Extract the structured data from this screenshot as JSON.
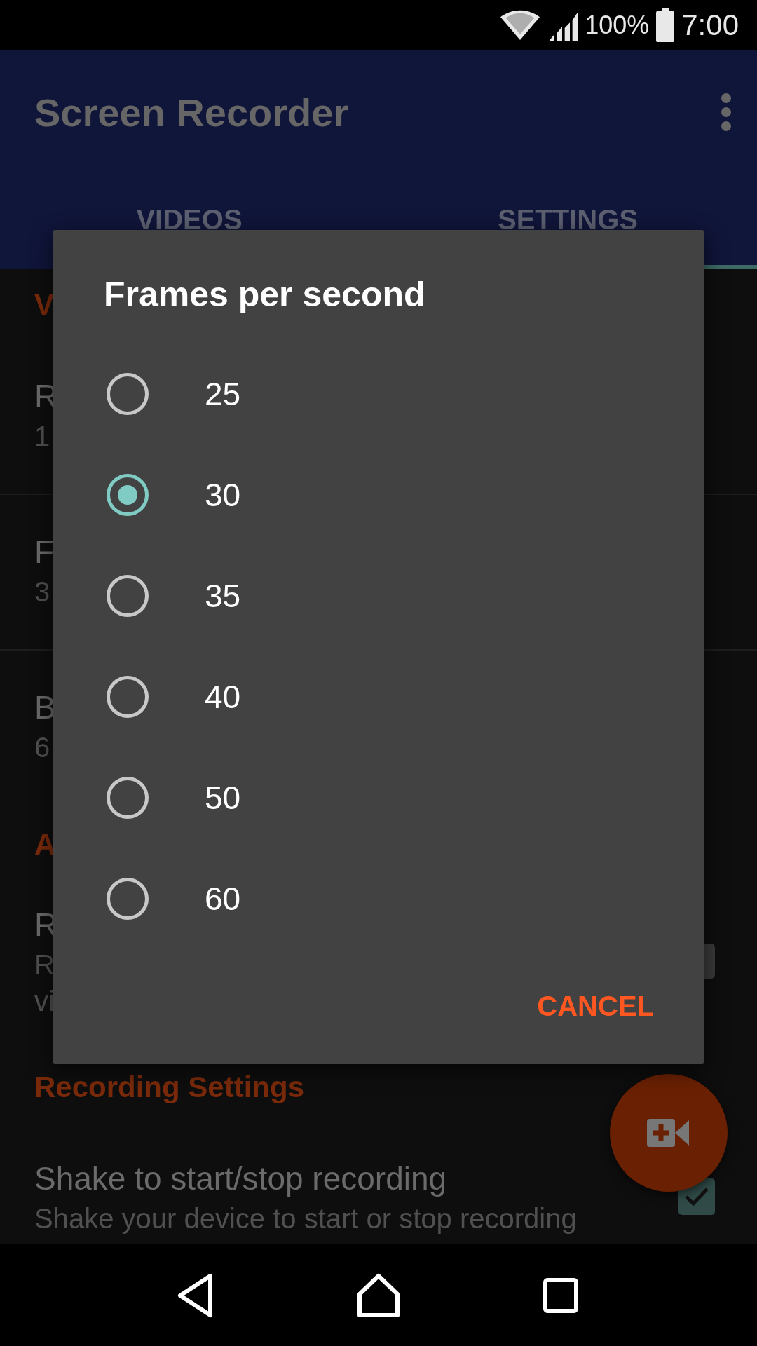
{
  "status_bar": {
    "battery_text": "100%",
    "time": "7:00"
  },
  "app_bar": {
    "title": "Screen Recorder"
  },
  "tabs": [
    {
      "label": "VIDEOS",
      "selected": false
    },
    {
      "label": "SETTINGS",
      "selected": true
    }
  ],
  "sections": [
    {
      "header": "V",
      "items": [
        {
          "title": "R",
          "summary": [
            "1"
          ],
          "kind": "plain"
        },
        {
          "title": "F",
          "summary": [
            "3"
          ],
          "kind": "plain"
        },
        {
          "title": "B",
          "summary": [
            "6"
          ],
          "kind": "plain"
        }
      ]
    },
    {
      "header": "A",
      "items": [
        {
          "title": "R",
          "summary": [
            "R",
            "vi"
          ],
          "kind": "switch"
        }
      ]
    },
    {
      "header": "Recording Settings",
      "items": [
        {
          "title": "Shake to start/stop recording",
          "summary": [
            "Shake your device to start or stop recording"
          ],
          "kind": "checkbox",
          "checked": true
        }
      ]
    }
  ],
  "dialog": {
    "title": "Frames per second",
    "options": [
      {
        "label": "25",
        "selected": false
      },
      {
        "label": "30",
        "selected": true
      },
      {
        "label": "35",
        "selected": false
      },
      {
        "label": "40",
        "selected": false
      },
      {
        "label": "50",
        "selected": false
      },
      {
        "label": "60",
        "selected": false
      }
    ],
    "button": "CANCEL"
  }
}
